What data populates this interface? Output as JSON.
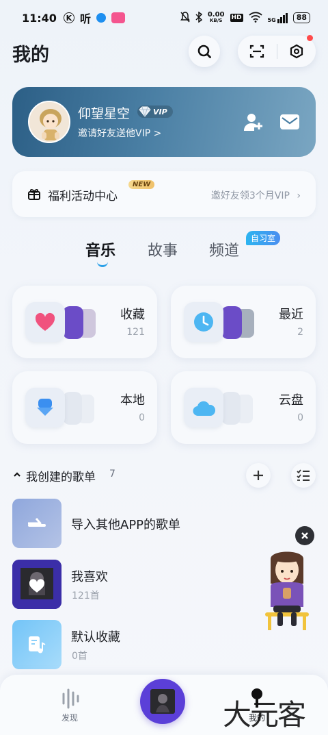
{
  "status_bar": {
    "time": "11:40",
    "app_icon_1": "K",
    "app_icon_2": "听",
    "net_speed": "0.00",
    "net_unit": "KB/S",
    "hd": "HD",
    "signal": "5G",
    "battery": "88"
  },
  "header": {
    "title": "我的"
  },
  "profile": {
    "username": "仰望星空",
    "vip_label": "VIP",
    "invite_text": "邀请好友送他VIP >"
  },
  "welfare": {
    "title": "福利活动中心",
    "new_badge": "NEW",
    "promo": "邀好友领3个月VIP"
  },
  "tabs": [
    {
      "label": "音乐"
    },
    {
      "label": "故事"
    },
    {
      "label": "频道"
    }
  ],
  "study_room_badge": "自习室",
  "tiles": [
    {
      "label": "收藏",
      "count": "121"
    },
    {
      "label": "最近",
      "count": "2"
    },
    {
      "label": "本地",
      "count": "0"
    },
    {
      "label": "云盘",
      "count": "0"
    }
  ],
  "playlists_section": {
    "title": "我创建的歌单",
    "count": "7"
  },
  "playlists": [
    {
      "name": "导入其他APP的歌单",
      "sub": ""
    },
    {
      "name": "我喜欢",
      "sub": "121首"
    },
    {
      "name": "默认收藏",
      "sub": "0首"
    }
  ],
  "bottom_nav": {
    "discover": "发现",
    "mine": "我的"
  },
  "watermark": "大元客",
  "colors": {
    "accent": "#2ba0e8",
    "profile_card": "#2c5f86",
    "player": "#5b3fd8"
  }
}
